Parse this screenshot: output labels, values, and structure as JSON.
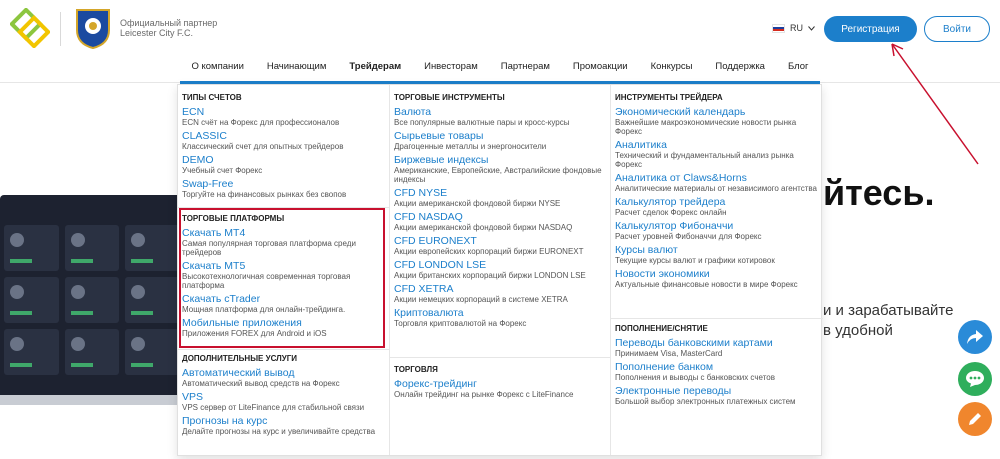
{
  "header": {
    "partner_line1": "Официальный партнер",
    "partner_line2": "Leicester City F.C.",
    "lang": "RU",
    "register": "Регистрация",
    "login": "Войти"
  },
  "nav": {
    "items": [
      "О компании",
      "Начинающим",
      "Трейдерам",
      "Инвесторам",
      "Партнерам",
      "Промоакции",
      "Конкурсы",
      "Поддержка",
      "Блог"
    ]
  },
  "menu": {
    "accounts": {
      "title": "ТИПЫ СЧЕТОВ",
      "items": [
        {
          "label": "ECN",
          "desc": "ECN счёт на Форекс для профессионалов"
        },
        {
          "label": "CLASSIC",
          "desc": "Классический счет для опытных трейдеров"
        },
        {
          "label": "DEMO",
          "desc": "Учебный счет Форекс"
        },
        {
          "label": "Swap-Free",
          "desc": "Торгуйте на финансовых рынках без свопов"
        }
      ]
    },
    "platforms": {
      "title": "ТОРГОВЫЕ ПЛАТФОРМЫ",
      "items": [
        {
          "label": "Скачать MT4",
          "desc": "Самая популярная торговая платформа среди трейдеров"
        },
        {
          "label": "Скачать MT5",
          "desc": "Высокотехнологичная современная торговая платформа"
        },
        {
          "label": "Скачать cTrader",
          "desc": "Мощная платформа для онлайн-трейдинга."
        },
        {
          "label": "Мобильные приложения",
          "desc": "Приложения FOREX для Android и iOS"
        }
      ]
    },
    "services": {
      "title": "ДОПОЛНИТЕЛЬНЫЕ УСЛУГИ",
      "items": [
        {
          "label": "Автоматический вывод",
          "desc": "Автоматический вывод средств на Форекс"
        },
        {
          "label": "VPS",
          "desc": "VPS сервер от LiteFinance для стабильной связи"
        },
        {
          "label": "Прогнозы на курс",
          "desc": "Делайте прогнозы на курс и увеличивайте средства"
        }
      ]
    },
    "instruments": {
      "title": "ТОРГОВЫЕ ИНСТРУМЕНТЫ",
      "items": [
        {
          "label": "Валюта",
          "desc": "Все популярные валютные пары и кросс-курсы"
        },
        {
          "label": "Сырьевые товары",
          "desc": "Драгоценные металлы и энергоносители"
        },
        {
          "label": "Биржевые индексы",
          "desc": "Американские, Европейские, Австралийские фондовые индексы"
        },
        {
          "label": "CFD NYSE",
          "desc": "Акции американской фондовой биржи NYSE"
        },
        {
          "label": "CFD NASDAQ",
          "desc": "Акции американской фондовой биржи NASDAQ"
        },
        {
          "label": "CFD EURONEXT",
          "desc": "Акции европейских корпораций биржи EURONEXT"
        },
        {
          "label": "CFD LONDON LSE",
          "desc": "Акции британских корпораций биржи LONDON LSE"
        },
        {
          "label": "CFD XETRA",
          "desc": "Акции немецких корпораций в системе XETRA"
        },
        {
          "label": "Криптовалюта",
          "desc": "Торговля криптовалютой на Форекс"
        }
      ]
    },
    "trading": {
      "title": "ТОРГОВЛЯ",
      "items": [
        {
          "label": "Форекс-трейдинг",
          "desc": "Онлайн трейдинг на рынке Форекс с LiteFinance"
        }
      ]
    },
    "tools": {
      "title": "ИНСТРУМЕНТЫ ТРЕЙДЕРА",
      "items": [
        {
          "label": "Экономический календарь",
          "desc": "Важнейшие макроэкономические новости рынка Форекс"
        },
        {
          "label": "Аналитика",
          "desc": "Технический и фундаментальный анализ рынка Форекс"
        },
        {
          "label": "Аналитика от Claws&Horns",
          "desc": "Аналитические материалы от независимого агентства"
        },
        {
          "label": "Калькулятор трейдера",
          "desc": "Расчет сделок Форекс онлайн"
        },
        {
          "label": "Калькулятор Фибоначчи",
          "desc": "Расчет уровней Фибоначчи для Форекс"
        },
        {
          "label": "Курсы валют",
          "desc": "Текущие курсы валют и графики котировок"
        },
        {
          "label": "Новости экономики",
          "desc": "Актуальные финансовые новости в мире Форекс"
        }
      ]
    },
    "funding": {
      "title": "ПОПОЛНЕНИЕ/СНЯТИЕ",
      "items": [
        {
          "label": "Переводы банковскими картами",
          "desc": "Принимаем Visa, MasterCard"
        },
        {
          "label": "Пополнение банком",
          "desc": "Пополнения и выводы с банковских счетов"
        },
        {
          "label": "Электронные переводы",
          "desc": "Большой выбор электронных платежных систем"
        }
      ]
    }
  },
  "hero": {
    "big": "йтесь.",
    "line1": "и и зарабатывайте",
    "line2": "в удобной"
  },
  "colors": {
    "brand_blue": "#1c7fcb",
    "highlight_red": "#c8102e",
    "logo_green": "#8cc63f",
    "logo_yellow": "#f2c500"
  }
}
